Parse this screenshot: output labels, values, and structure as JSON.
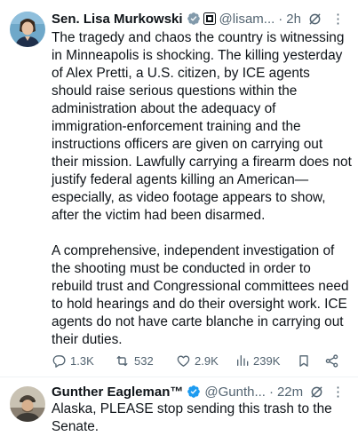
{
  "main_tweet": {
    "author_name": "Sen. Lisa Murkowski",
    "handle": "@lisam...",
    "separator": "·",
    "time": "2h",
    "more_label": "⋮",
    "paragraphs": [
      "The tragedy and chaos the country is witnessing in Minneapolis is shocking. The killing yesterday of Alex Pretti, a U.S. citizen, by ICE agents should raise serious questions within the administration about the adequacy of immigration-enforcement training and the instructions officers are given on carrying out their mission. Lawfully carrying a firearm does not justify federal agents killing an American—especially, as video footage appears to show, after the victim had been disarmed.",
      "A comprehensive, independent investigation of the shooting must be conducted in order to rebuild trust and Congressional committees need to hold hearings and do their oversight work. ICE agents do not have carte blanche in carrying out their duties."
    ],
    "metrics": {
      "replies": "1.3K",
      "reposts": "532",
      "likes": "2.9K",
      "views": "239K"
    }
  },
  "reply_tweet": {
    "author_name": "Gunther Eagleman™",
    "handle": "@Gunth...",
    "separator": "·",
    "time": "22m",
    "more_label": "⋮",
    "text": "Alaska,  PLEASE stop sending this trash to the Senate."
  },
  "colors": {
    "verified_blue": "#1d9bf0",
    "muted": "#536471",
    "text": "#0f1419",
    "divider": "#eff3f4"
  },
  "icons": [
    "verified-badge-icon",
    "government-badge-icon",
    "grok-icon",
    "more-options-icon",
    "reply-icon",
    "repost-icon",
    "like-icon",
    "views-icon",
    "bookmark-icon",
    "share-icon"
  ]
}
